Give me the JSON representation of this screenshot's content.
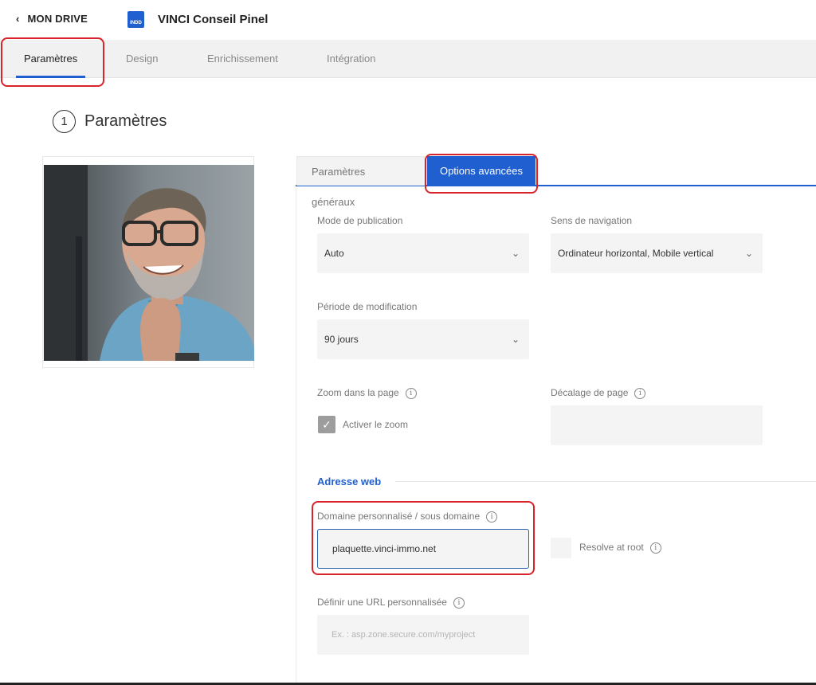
{
  "header": {
    "back_label": "MON DRIVE",
    "doc_icon_text": "INDD",
    "doc_title": "VINCI Conseil Pinel"
  },
  "main_tabs": [
    {
      "label": "Paramètres",
      "active": true
    },
    {
      "label": "Design",
      "active": false
    },
    {
      "label": "Enrichissement",
      "active": false
    },
    {
      "label": "Intégration",
      "active": false
    }
  ],
  "section": {
    "step_number": "1",
    "title": "Paramètres"
  },
  "panel_tabs": [
    {
      "label": "Paramètres généraux",
      "active": false
    },
    {
      "label": "Options avancées",
      "active": true
    }
  ],
  "form": {
    "publication_mode": {
      "label": "Mode de publication",
      "value": "Auto"
    },
    "navigation": {
      "label": "Sens de navigation",
      "value": "Ordinateur horizontal, Mobile vertical"
    },
    "modification_period": {
      "label": "Période de modification",
      "value": "90 jours"
    },
    "zoom": {
      "label": "Zoom dans la page",
      "checkbox_label": "Activer le zoom",
      "checked": true
    },
    "page_offset": {
      "label": "Décalage de page",
      "value": ""
    },
    "web_address": {
      "title": "Adresse web"
    },
    "custom_domain": {
      "label": "Domaine personnalisé / sous domaine",
      "value": "plaquette.vinci-immo.net"
    },
    "resolve_root": {
      "label": "Resolve at root",
      "checked": false
    },
    "custom_url": {
      "label": "Définir une URL personnalisée",
      "placeholder": "Ex. : asp.zone.secure.com/myproject"
    }
  },
  "colors": {
    "accent": "#1f5fd0",
    "highlight": "#d8232a"
  }
}
